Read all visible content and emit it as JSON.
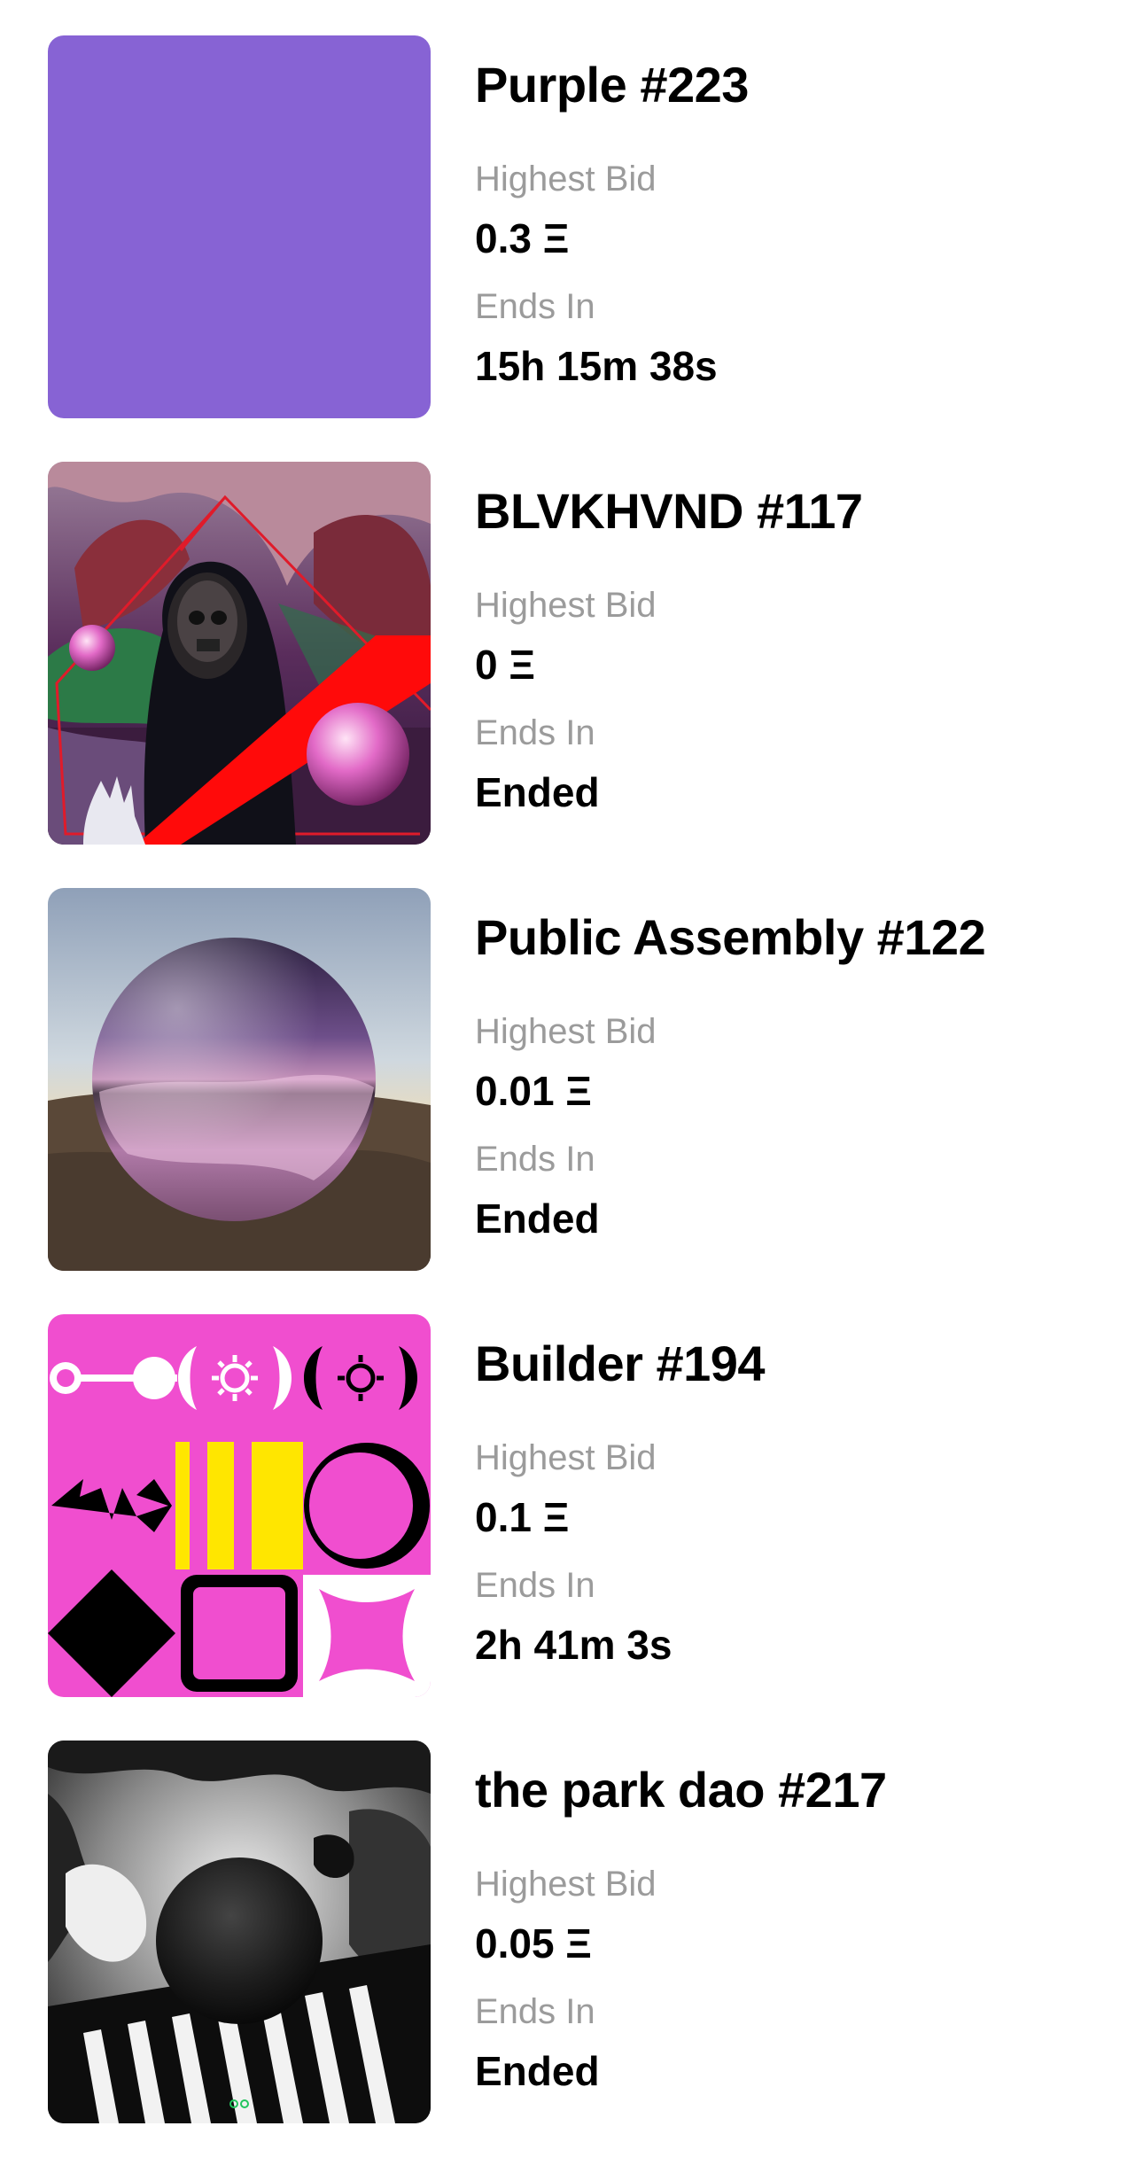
{
  "auctions": [
    {
      "title": "Purple #223",
      "bid_label": "Highest Bid",
      "bid_value": "0.3 Ξ",
      "ends_label": "Ends In",
      "ends_value": "15h 15m 38s",
      "image_color": "#8763d4"
    },
    {
      "title": "BLVKHVND #117",
      "bid_label": "Highest Bid",
      "bid_value": "0 Ξ",
      "ends_label": "Ends In",
      "ends_value": "Ended"
    },
    {
      "title": "Public Assembly #122",
      "bid_label": "Highest Bid",
      "bid_value": "0.01 Ξ",
      "ends_label": "Ends In",
      "ends_value": "Ended"
    },
    {
      "title": "Builder #194",
      "bid_label": "Highest Bid",
      "bid_value": "0.1 Ξ",
      "ends_label": "Ends In",
      "ends_value": "2h 41m 3s",
      "image_color": "#f04ecf"
    },
    {
      "title": "the park dao #217",
      "bid_label": "Highest Bid",
      "bid_value": "0.05 Ξ",
      "ends_label": "Ends In",
      "ends_value": "Ended"
    }
  ]
}
